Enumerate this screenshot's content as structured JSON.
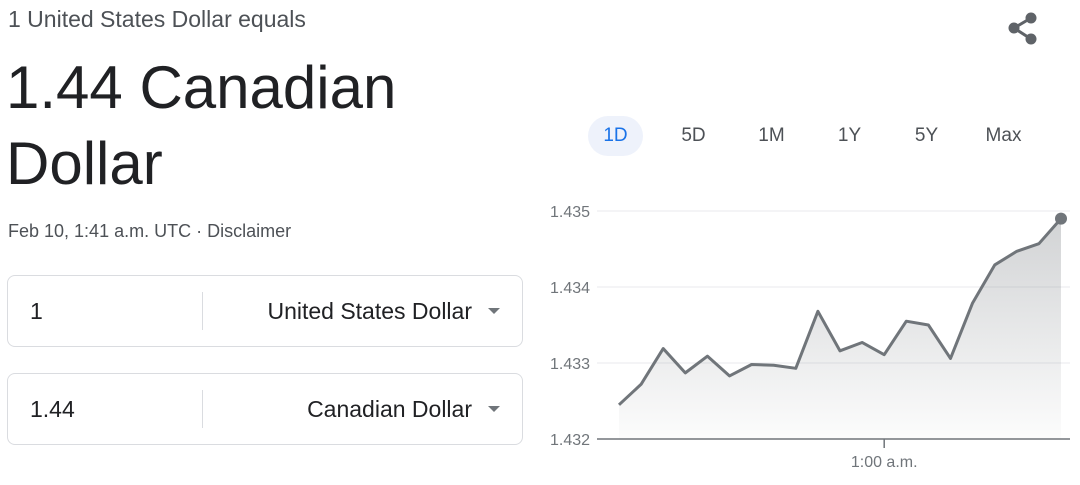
{
  "header": {
    "subtitle": "1 United States Dollar equals",
    "rate_line1": "1.44 Canadian",
    "rate_line2": "Dollar",
    "timestamp": "Feb 10, 1:41 a.m. UTC",
    "separator": " · ",
    "disclaimer": "Disclaimer"
  },
  "share_icon": "share-icon",
  "converter": {
    "from": {
      "amount": "1",
      "currency": "United States Dollar"
    },
    "to": {
      "amount": "1.44",
      "currency": "Canadian Dollar"
    }
  },
  "range_tabs": {
    "items": [
      "1D",
      "5D",
      "1M",
      "1Y",
      "5Y",
      "Max"
    ],
    "active": "1D"
  },
  "colors": {
    "line": "#70757a",
    "accent": "#1a73e8",
    "active_tab_bg": "#eef2fb",
    "grid": "#e8eaed"
  },
  "chart_data": {
    "type": "area",
    "y_ticks": [
      "1.435",
      "1.434",
      "1.433",
      "1.432"
    ],
    "ylim": [
      1.432,
      1.435
    ],
    "x_tick_label": "1:00 a.m.",
    "values": [
      1.43245,
      1.43272,
      1.43319,
      1.43287,
      1.43309,
      1.43283,
      1.43298,
      1.43297,
      1.43293,
      1.43368,
      1.43316,
      1.43327,
      1.43311,
      1.43355,
      1.4335,
      1.43306,
      1.43379,
      1.43429,
      1.43447,
      1.43457,
      1.4349
    ],
    "x_tick_index": 12,
    "grid": true
  }
}
